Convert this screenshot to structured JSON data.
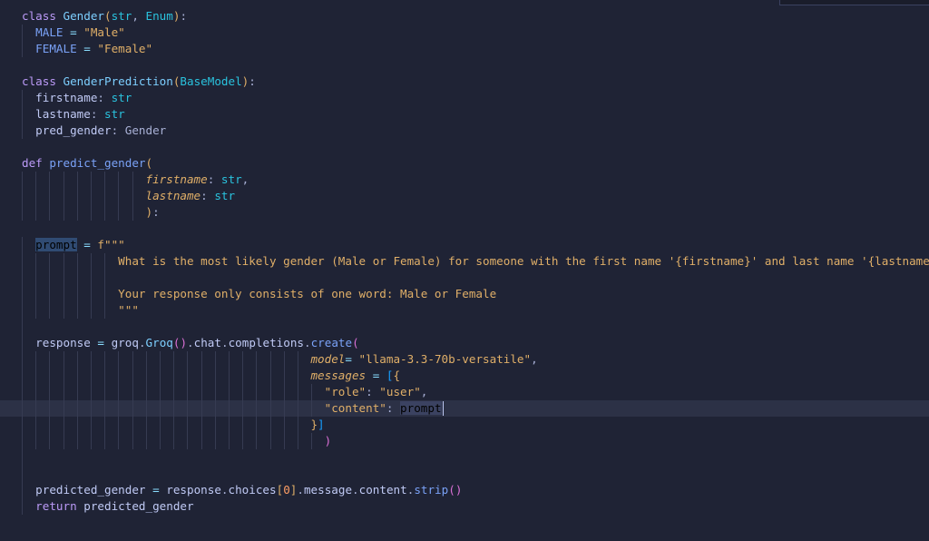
{
  "editor": {
    "language": "python",
    "lines": [
      [
        [
          "kw",
          "class "
        ],
        [
          "cls",
          "Gender"
        ],
        [
          "br1",
          "("
        ],
        [
          "ty",
          "str"
        ],
        [
          "txt",
          ", "
        ],
        [
          "ty",
          "Enum"
        ],
        [
          "br1",
          ")"
        ],
        [
          "txt",
          ":"
        ]
      ],
      [
        [
          "txt",
          "  "
        ],
        [
          "con",
          "MALE"
        ],
        [
          "op",
          " = "
        ],
        [
          "str",
          "\"Male\""
        ]
      ],
      [
        [
          "txt",
          "  "
        ],
        [
          "con",
          "FEMALE"
        ],
        [
          "op",
          " = "
        ],
        [
          "str",
          "\"Female\""
        ]
      ],
      [],
      [
        [
          "kw",
          "class "
        ],
        [
          "cls",
          "GenderPrediction"
        ],
        [
          "br1",
          "("
        ],
        [
          "ty",
          "BaseModel"
        ],
        [
          "br1",
          ")"
        ],
        [
          "txt",
          ":"
        ]
      ],
      [
        [
          "txt",
          "  "
        ],
        [
          "var",
          "firstname"
        ],
        [
          "txt",
          ": "
        ],
        [
          "ty",
          "str"
        ]
      ],
      [
        [
          "txt",
          "  "
        ],
        [
          "var",
          "lastname"
        ],
        [
          "txt",
          ": "
        ],
        [
          "ty",
          "str"
        ]
      ],
      [
        [
          "txt",
          "  "
        ],
        [
          "var",
          "pred_gender"
        ],
        [
          "txt",
          ": "
        ],
        [
          "txt",
          "Gender"
        ]
      ],
      [],
      [
        [
          "kw",
          "def "
        ],
        [
          "fn",
          "predict_gender"
        ],
        [
          "br1",
          "("
        ]
      ],
      [
        [
          "txt",
          "                  "
        ],
        [
          "prm",
          "firstname"
        ],
        [
          "txt",
          ": "
        ],
        [
          "ty",
          "str"
        ],
        [
          "txt",
          ","
        ]
      ],
      [
        [
          "txt",
          "                  "
        ],
        [
          "prm",
          "lastname"
        ],
        [
          "txt",
          ": "
        ],
        [
          "ty",
          "str"
        ]
      ],
      [
        [
          "txt",
          "                  "
        ],
        [
          "br1",
          ")"
        ],
        [
          "txt",
          ":"
        ]
      ],
      [],
      [
        [
          "txt",
          "  "
        ],
        [
          "hl",
          "prompt"
        ],
        [
          "op",
          " = "
        ],
        [
          "str",
          "f\"\"\""
        ]
      ],
      [
        [
          "txt",
          "              "
        ],
        [
          "str",
          "What is the most likely gender (Male or Female) for someone with the first name '{firstname}' and last name '{lastname}' ?"
        ]
      ],
      [],
      [
        [
          "txt",
          "              "
        ],
        [
          "str",
          "Your response only consists of one word: Male or Female"
        ]
      ],
      [
        [
          "txt",
          "              "
        ],
        [
          "str",
          "\"\"\""
        ]
      ],
      [],
      [
        [
          "txt",
          "  "
        ],
        [
          "var",
          "response"
        ],
        [
          "op",
          " = "
        ],
        [
          "var",
          "groq"
        ],
        [
          "txt",
          "."
        ],
        [
          "cls",
          "Groq"
        ],
        [
          "br2",
          "()"
        ],
        [
          "txt",
          "."
        ],
        [
          "var",
          "chat"
        ],
        [
          "txt",
          "."
        ],
        [
          "var",
          "completions"
        ],
        [
          "txt",
          "."
        ],
        [
          "fn",
          "create"
        ],
        [
          "br2",
          "("
        ]
      ],
      [
        [
          "txt",
          "                                          "
        ],
        [
          "prm",
          "model"
        ],
        [
          "op",
          "= "
        ],
        [
          "str",
          "\"llama-3.3-70b-versatile\""
        ],
        [
          "txt",
          ","
        ]
      ],
      [
        [
          "txt",
          "                                          "
        ],
        [
          "prm",
          "messages"
        ],
        [
          "op",
          " = "
        ],
        [
          "br3",
          "["
        ],
        [
          "br1",
          "{"
        ]
      ],
      [
        [
          "txt",
          "                                            "
        ],
        [
          "str",
          "\"role\""
        ],
        [
          "txt",
          ": "
        ],
        [
          "str",
          "\"user\""
        ],
        [
          "txt",
          ","
        ]
      ],
      [
        [
          "txt",
          "                                            "
        ],
        [
          "str",
          "\"content\""
        ],
        [
          "txt",
          ": "
        ],
        [
          "sel",
          "prompt"
        ]
      ],
      [
        [
          "txt",
          "                                          "
        ],
        [
          "br1",
          "}"
        ],
        [
          "br3",
          "]"
        ]
      ],
      [
        [
          "txt",
          "                                            "
        ],
        [
          "br2",
          ")"
        ]
      ],
      [],
      [],
      [
        [
          "txt",
          "  "
        ],
        [
          "var",
          "predicted_gender"
        ],
        [
          "op",
          " = "
        ],
        [
          "var",
          "response"
        ],
        [
          "txt",
          "."
        ],
        [
          "var",
          "choices"
        ],
        [
          "br1",
          "["
        ],
        [
          "num",
          "0"
        ],
        [
          "br1",
          "]"
        ],
        [
          "txt",
          "."
        ],
        [
          "var",
          "message"
        ],
        [
          "txt",
          "."
        ],
        [
          "var",
          "content"
        ],
        [
          "txt",
          "."
        ],
        [
          "fn",
          "strip"
        ],
        [
          "br2",
          "()"
        ]
      ],
      [
        [
          "txt",
          "  "
        ],
        [
          "kw",
          "return "
        ],
        [
          "var",
          "predicted_gender"
        ]
      ]
    ],
    "current_line": 25
  }
}
